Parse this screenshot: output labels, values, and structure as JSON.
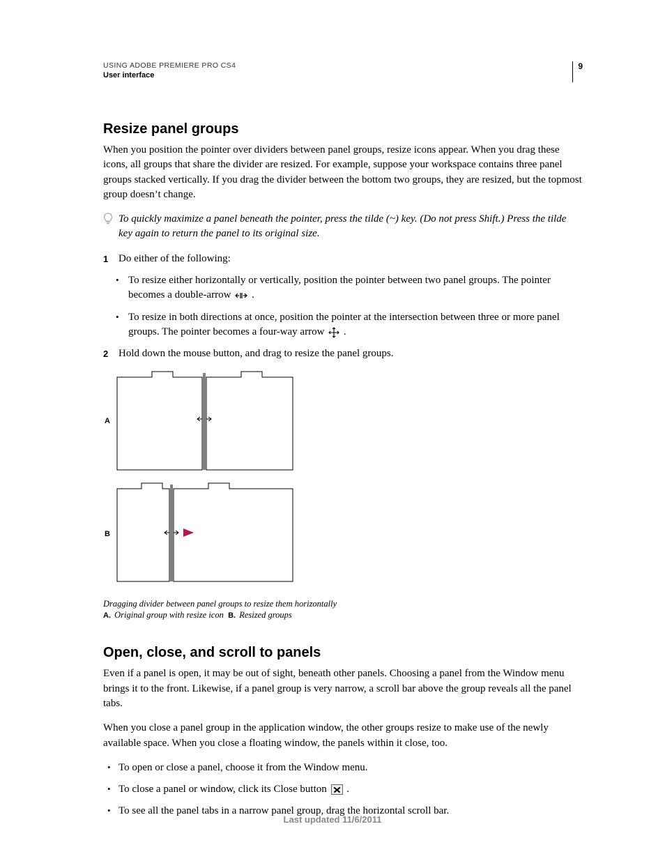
{
  "header": {
    "line1": "USING ADOBE PREMIERE PRO CS4",
    "line2": "User interface",
    "page": "9"
  },
  "s1": {
    "heading": "Resize panel groups",
    "p1": "When you position the pointer over dividers between panel groups, resize icons appear. When you drag these icons, all groups that share the divider are resized. For example, suppose your workspace contains three panel groups stacked vertically. If you drag the divider between the bottom two groups, they are resized, but the topmost group doesn’t change.",
    "tip": "To quickly maximize a panel beneath the pointer, press the tilde (~) key. (Do not press Shift.) Press the tilde key again to return the panel to its original size.",
    "step1": "Do either of the following:",
    "b1a": "To resize either horizontally or vertically, position the pointer between two panel groups. The pointer becomes a double-arrow ",
    "b1b": ".",
    "b2a": "To resize in both directions at once, position the pointer at the intersection between three or more panel groups. The pointer becomes a four-way arrow ",
    "b2b": ".",
    "step2": "Hold down the mouse button, and drag to resize the panel groups.",
    "cap1": "Dragging divider between panel groups to resize them horizontally",
    "cap2a_lbl": "A.",
    "cap2a": "Original group with resize icon",
    "cap2b_lbl": "B.",
    "cap2b": "Resized groups",
    "figA": "A",
    "figB": "B"
  },
  "s2": {
    "heading": "Open, close, and scroll to panels",
    "p1": "Even if a panel is open, it may be out of sight, beneath other panels. Choosing a panel from the Window menu brings it to the front. Likewise, if a panel group is very narrow, a scroll bar above the group reveals all the panel tabs.",
    "p2": "When you close a panel group in the application window, the other groups resize to make use of the newly available space. When you close a floating window, the panels within it close, too.",
    "b1": "To open or close a panel, choose it from the Window menu.",
    "b2a": "To close a panel or window, click its Close button ",
    "b2b": ".",
    "b3": "To see all the panel tabs in a narrow panel group, drag the horizontal scroll bar."
  },
  "footer": "Last updated 11/6/2011"
}
